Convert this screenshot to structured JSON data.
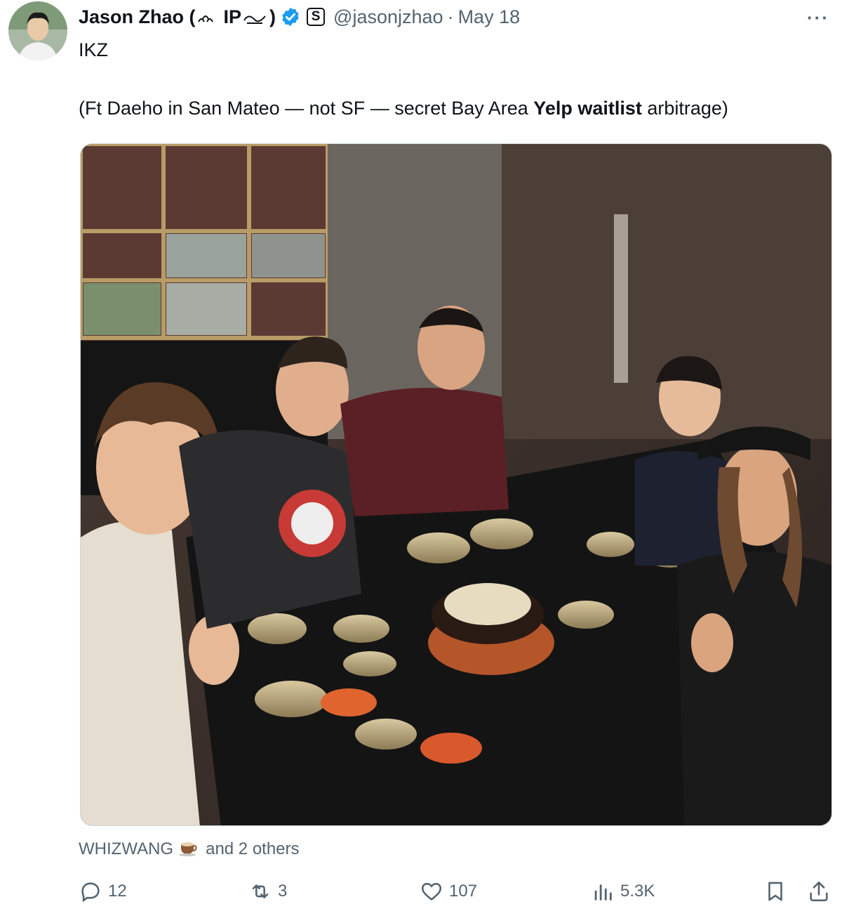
{
  "tweet": {
    "author_name": "Jason Zhao (",
    "author_name_suffix": ")",
    "author_name_decoration": "IP",
    "badge_letter": "S",
    "handle": "@jasonjzhao",
    "separator": "·",
    "date": "May 18",
    "more_label": "···",
    "line1": "IKZ",
    "line2_part1": "(Ft Daeho in San Mateo — not SF — secret Bay Area ",
    "line2_bold": "Yelp waitlist",
    "line2_part2": " arbitrage)"
  },
  "liked_by": {
    "name": "WHIZWANG",
    "rest": "and 2 others"
  },
  "actions": {
    "replies": "12",
    "reposts": "3",
    "likes": "107",
    "views": "5.3K"
  },
  "icons": [
    "avatar",
    "verified-badge-icon",
    "more-icon",
    "coffee-emoji-icon",
    "reply-icon",
    "repost-icon",
    "like-icon",
    "views-icon",
    "bookmark-icon",
    "share-icon"
  ],
  "colors": {
    "verified_blue": "#1d9bf0",
    "secondary_text": "#536471",
    "primary_text": "#0f1419"
  }
}
